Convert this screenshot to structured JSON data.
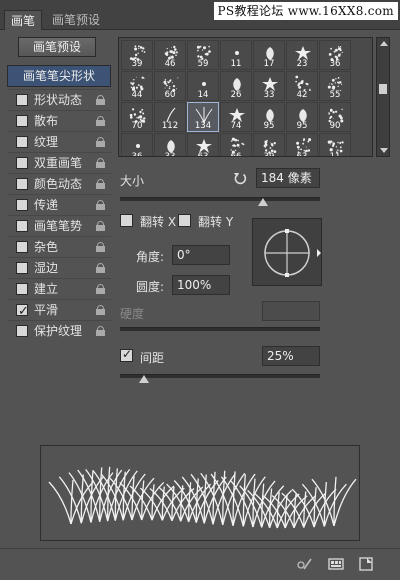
{
  "tabs": [
    {
      "label": "画笔"
    },
    {
      "label": "画笔预设"
    }
  ],
  "watermark": "PS教程论坛 www.16XX8.com",
  "brush_presets_button": "画笔预设",
  "brush_tip_shape": "画笔笔尖形状",
  "options": [
    {
      "label": "形状动态",
      "checked": false
    },
    {
      "label": "散布",
      "checked": false
    },
    {
      "label": "纹理",
      "checked": false
    },
    {
      "label": "双重画笔",
      "checked": false
    },
    {
      "label": "颜色动态",
      "checked": false
    },
    {
      "label": "传递",
      "checked": false
    },
    {
      "label": "画笔笔势",
      "checked": false
    },
    {
      "label": "杂色",
      "checked": false
    },
    {
      "label": "湿边",
      "checked": false
    },
    {
      "label": "建立",
      "checked": false
    },
    {
      "label": "平滑",
      "checked": true
    },
    {
      "label": "保护纹理",
      "checked": false
    }
  ],
  "brush_grid": [
    [
      "39",
      "46",
      "59",
      "11",
      "17",
      "23",
      "36"
    ],
    [
      "44",
      "60",
      "14",
      "26",
      "33",
      "42",
      "55"
    ],
    [
      "70",
      "112",
      "134",
      "74",
      "95",
      "95",
      "90"
    ],
    [
      "36",
      "33",
      "63",
      "66",
      "39",
      "63",
      "11"
    ]
  ],
  "selected_brush": "134",
  "size": {
    "label": "大小",
    "value": "184 像素"
  },
  "flip_x": {
    "label": "翻转 X",
    "checked": false
  },
  "flip_y": {
    "label": "翻转 Y",
    "checked": false
  },
  "angle": {
    "label": "角度:",
    "value": "0°"
  },
  "roundness": {
    "label": "圆度:",
    "value": "100%"
  },
  "hardness": {
    "label": "硬度",
    "value": ""
  },
  "spacing": {
    "label": "间距",
    "value": "25%",
    "checked": true
  }
}
